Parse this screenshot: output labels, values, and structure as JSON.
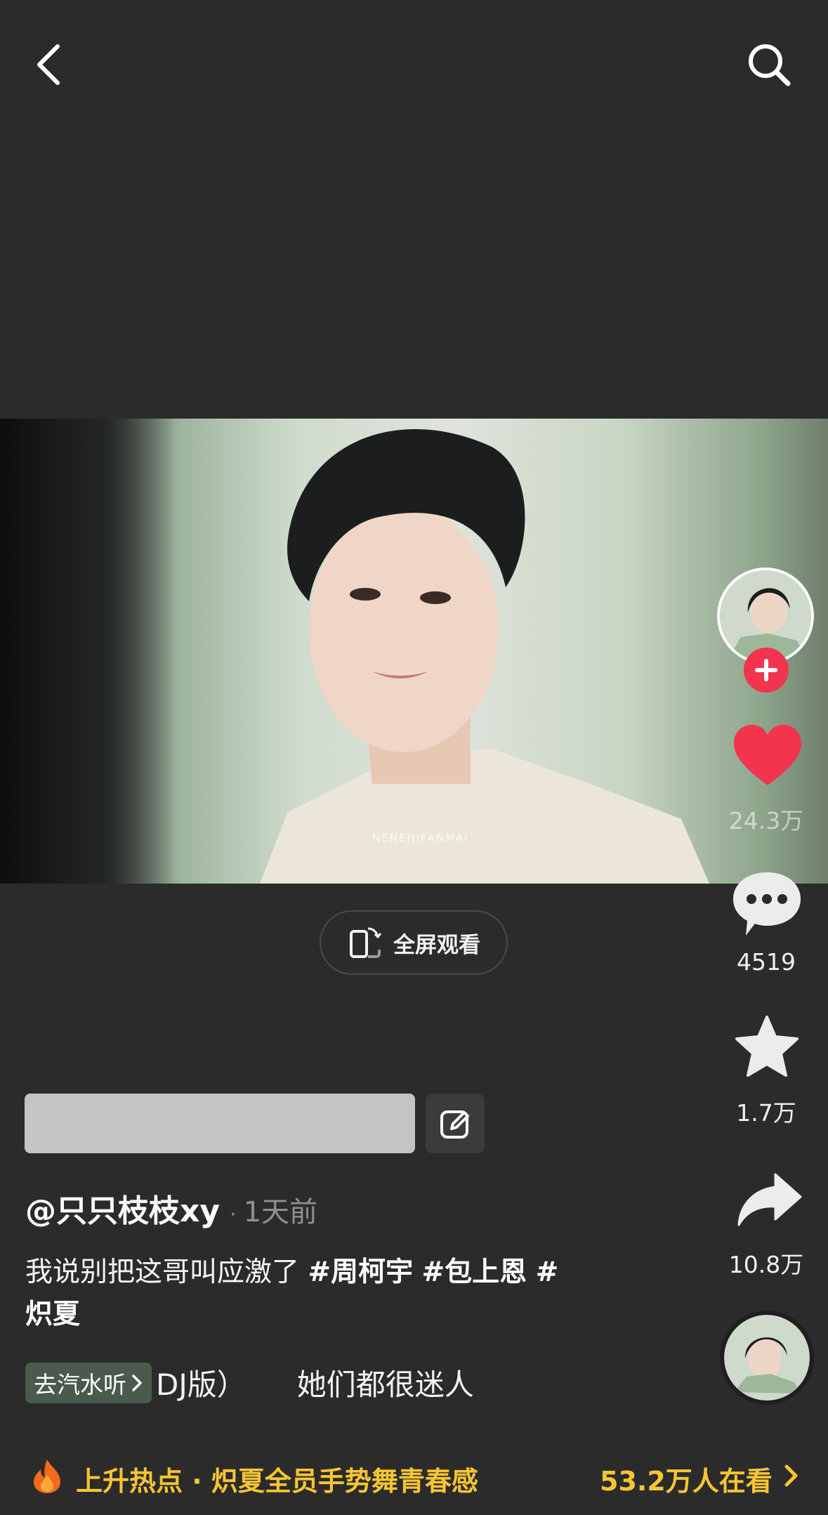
{
  "top_bar": {
    "back_icon": "chevron-left-icon",
    "search_icon": "search-icon"
  },
  "player": {
    "fullscreen_label": "全屏观看",
    "fullscreen_icon": "rotate-phone-icon",
    "watermark": "NENEHIFANMAI"
  },
  "side_actions": {
    "follow_icon": "plus-icon",
    "likes": "24.3万",
    "comments": "4519",
    "favorites": "1.7万",
    "shares": "10.8万",
    "like_color": "#f2344f"
  },
  "post": {
    "author": "@只只枝枝xy",
    "separator": "·",
    "time": "1天前",
    "caption_text": "我说别把这哥叫应激了 ",
    "tags": [
      "#周柯宇",
      "#包上恩",
      "#",
      "炽夏"
    ],
    "edit_icon": "edit-icon"
  },
  "music": {
    "qishui_label": "去汽水听",
    "song_fragment": "DJ版）",
    "artist_fragment": "她们都很迷人"
  },
  "hot": {
    "label": "上升热点 · 炽夏全员手势舞青春感",
    "viewers": "53.2万人在看",
    "accent_color": "#f6c531"
  }
}
